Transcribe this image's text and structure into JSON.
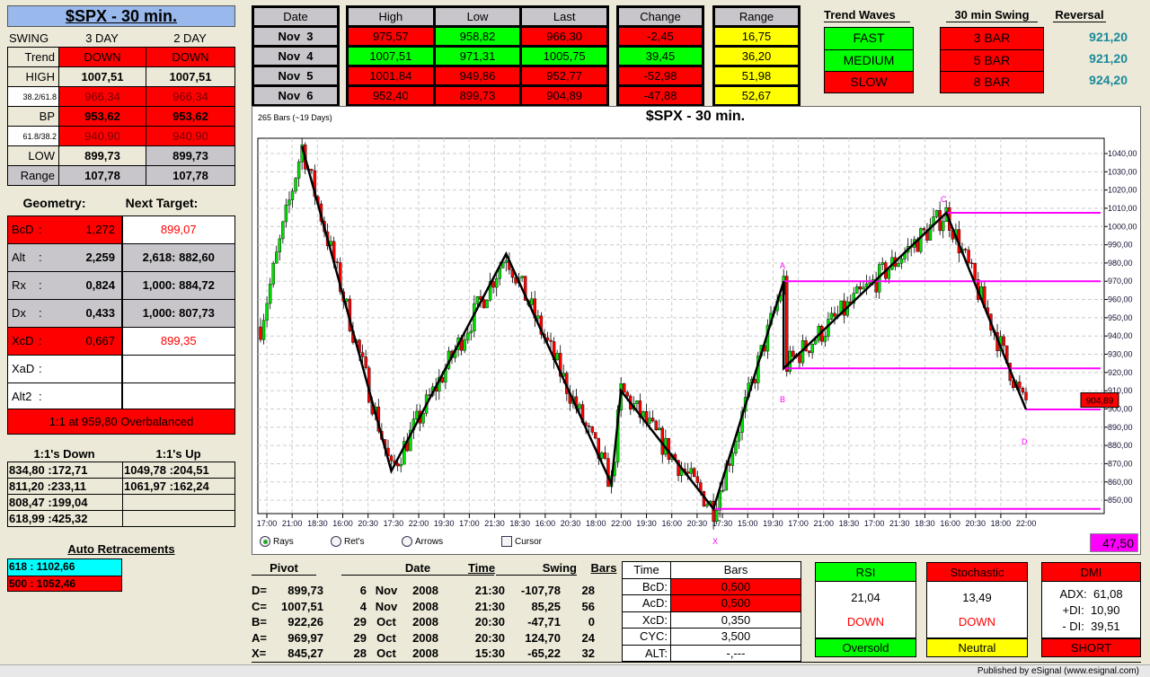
{
  "header": {
    "title": "$SPX - 30 min."
  },
  "swing": {
    "label": "SWING",
    "cols": [
      "3 DAY",
      "2 DAY"
    ],
    "rows": [
      {
        "label": "Trend",
        "values": [
          "DOWN",
          "DOWN"
        ],
        "lc": "beige",
        "vc": [
          "red",
          "red"
        ],
        "tc": ""
      },
      {
        "label": "HIGH",
        "values": [
          "1007,51",
          "1007,51"
        ],
        "lc": "beige",
        "vc": [
          "beige",
          "beige"
        ],
        "tc": "bold"
      },
      {
        "label": "38.2/61.8",
        "values": [
          "966,34",
          "966,34"
        ],
        "lc": "white small",
        "vc": [
          "red",
          "red"
        ],
        "tc": "maroon"
      },
      {
        "label": "BP",
        "values": [
          "953,62",
          "953,62"
        ],
        "lc": "beige",
        "vc": [
          "red",
          "red"
        ],
        "tc": "bold"
      },
      {
        "label": "61.8/38.2",
        "values": [
          "940,90",
          "940,90"
        ],
        "lc": "white small",
        "vc": [
          "red",
          "red"
        ],
        "tc": "maroon"
      },
      {
        "label": "LOW",
        "values": [
          "899,73",
          "899,73"
        ],
        "lc": "beige",
        "vc": [
          "beige",
          "gray"
        ],
        "tc": "bold"
      },
      {
        "label": "Range",
        "values": [
          "107,78",
          "107,78"
        ],
        "lc": "gray",
        "vc": [
          "gray",
          "gray"
        ],
        "tc": "bold"
      }
    ]
  },
  "geometry": {
    "label": "Geometry:",
    "target_label": "Next Target:",
    "rows": [
      {
        "name": "BcD",
        "sep": ":",
        "ratio": "1,272",
        "target": "899,07",
        "lc": "red",
        "tc": "white rtext"
      },
      {
        "name": "Alt",
        "sep": ":",
        "ratio": "2,259",
        "target": "2,618: 882,60",
        "lc": "gray",
        "tc": "gray bold"
      },
      {
        "name": "Rx",
        "sep": ":",
        "ratio": "0,824",
        "target": "1,000: 884,72",
        "lc": "gray",
        "tc": "gray bold"
      },
      {
        "name": "Dx",
        "sep": ":",
        "ratio": "0,433",
        "target": "1,000: 807,73",
        "lc": "gray",
        "tc": "gray bold"
      },
      {
        "name": "XcD",
        "sep": ":",
        "ratio": "0,667",
        "target": "899,35",
        "lc": "red",
        "tc": "white rtext"
      },
      {
        "name": "XaD",
        "sep": ":",
        "ratio": "",
        "target": "",
        "lc": "white",
        "tc": "white"
      },
      {
        "name": "Alt2",
        "sep": ":",
        "ratio": "",
        "target": "",
        "lc": "white",
        "tc": "white"
      }
    ],
    "overbalanced": "1:1 at 959,80 Overbalanced"
  },
  "ones": {
    "down_label": "1:1's Down",
    "up_label": "1:1's Up",
    "down": [
      "834,80 :172,71",
      "811,20 :233,11",
      "808,47 :199,04",
      "618,99 :425,32"
    ],
    "up": [
      "1049,78 :204,51",
      "1061,97 :162,24",
      "",
      ""
    ]
  },
  "auto_retracements": {
    "label": "Auto Retracements",
    "items": [
      {
        "text": "618 : 1102,66",
        "c": "cyan"
      },
      {
        "text": "500 : 1052,46",
        "c": "red"
      }
    ]
  },
  "daily": {
    "headers": {
      "date": "Date",
      "high": "High",
      "low": "Low",
      "last": "Last",
      "change": "Change",
      "range": "Range"
    },
    "rows": [
      {
        "date": "Nov  3",
        "high": "975,57",
        "low": "958,82",
        "last": "966,30",
        "change": "-2,45",
        "range": "16,75",
        "c": [
          "red",
          "green",
          "red",
          "red"
        ]
      },
      {
        "date": "Nov  4",
        "high": "1007,51",
        "low": "971,31",
        "last": "1005,75",
        "change": "39,45",
        "range": "36,20",
        "c": [
          "green",
          "green",
          "green",
          "green"
        ]
      },
      {
        "date": "Nov  5",
        "high": "1001,84",
        "low": "949,86",
        "last": "952,77",
        "change": "-52,98",
        "range": "51,98",
        "c": [
          "red",
          "red",
          "red",
          "red"
        ]
      },
      {
        "date": "Nov  6",
        "high": "952,40",
        "low": "899,73",
        "last": "904,89",
        "change": "-47,88",
        "range": "52,67",
        "c": [
          "red",
          "red",
          "red",
          "red"
        ]
      }
    ]
  },
  "trend": {
    "waves_label": "Trend Waves",
    "swing_label": "30 min Swing",
    "reversal_label": "Reversal",
    "waves": [
      {
        "t": "FAST",
        "c": "green"
      },
      {
        "t": "MEDIUM",
        "c": "green"
      },
      {
        "t": "SLOW",
        "c": "red"
      }
    ],
    "swings": [
      {
        "t": "3 BAR",
        "c": "red"
      },
      {
        "t": "5 BAR",
        "c": "red"
      },
      {
        "t": "8 BAR",
        "c": "red"
      }
    ],
    "reversals": [
      "921,20",
      "921,20",
      "924,20"
    ]
  },
  "chart": {
    "bars_label": "265 Bars (~19 Days)",
    "title": "$SPX - 30 min.",
    "last_price": "904,89",
    "corner_value": "47,50",
    "y_ticks": [
      "1040,00",
      "1030,00",
      "1020,00",
      "1010,00",
      "1000,00",
      "990,00",
      "980,00",
      "970,00",
      "960,00",
      "950,00",
      "940,00",
      "930,00",
      "920,00",
      "910,00",
      "900,00",
      "890,00",
      "880,00",
      "870,00",
      "860,00",
      "850,00"
    ],
    "x_ticks": [
      "17:00",
      "21:00",
      "18:30",
      "16:00",
      "20:30",
      "17:30",
      "22:00",
      "19:30",
      "17:00",
      "21:30",
      "18:30",
      "16:00",
      "20:30",
      "18:00",
      "22:00",
      "19:30",
      "16:00",
      "20:30",
      "17:30",
      "15:00",
      "19:30",
      "17:00",
      "21:00",
      "18:30",
      "17:00",
      "21:30",
      "18:30",
      "16:00",
      "20:30",
      "18:00",
      "22:00"
    ],
    "pivot_labels": {
      "A": "A",
      "B": "B",
      "C": "C",
      "D": "D",
      "X": "X"
    },
    "pivots": [
      {
        "bar": 13,
        "price": 1044
      },
      {
        "bar": 41,
        "price": 866
      },
      {
        "bar": 77,
        "price": 985
      },
      {
        "bar": 110,
        "price": 859
      },
      {
        "bar": 113,
        "price": 910
      },
      {
        "bar": 142,
        "price": 845.27
      },
      {
        "bar": 164,
        "price": 969.97
      },
      {
        "bar": 164,
        "price": 922.26
      },
      {
        "bar": 215,
        "price": 1007.51
      },
      {
        "bar": 240,
        "price": 899.73
      }
    ],
    "levels": [
      {
        "price": 1007.51,
        "from_bar": 215
      },
      {
        "price": 969.97,
        "from_bar": 164
      },
      {
        "price": 922.26,
        "from_bar": 164
      },
      {
        "price": 899.73,
        "from_bar": 240
      },
      {
        "price": 845.27,
        "from_bar": 142
      }
    ],
    "options": {
      "rays": "Rays",
      "rets": "Ret's",
      "arrows": "Arrows",
      "cursor": "Cursor"
    }
  },
  "pivots_table": {
    "headers": [
      "Pivot",
      "Date",
      "Time",
      "Swing",
      "Bars"
    ],
    "rows": [
      {
        "p": "D=",
        "v": "899,73",
        "d": "6",
        "m": "Nov",
        "y": "2008",
        "t": "21:30",
        "s": "-107,78",
        "b": "28"
      },
      {
        "p": "C=",
        "v": "1007,51",
        "d": "4",
        "m": "Nov",
        "y": "2008",
        "t": "21:30",
        "s": "85,25",
        "b": "56"
      },
      {
        "p": "B=",
        "v": "922,26",
        "d": "29",
        "m": "Oct",
        "y": "2008",
        "t": "20:30",
        "s": "-47,71",
        "b": "0"
      },
      {
        "p": "A=",
        "v": "969,97",
        "d": "29",
        "m": "Oct",
        "y": "2008",
        "t": "20:30",
        "s": "124,70",
        "b": "24"
      },
      {
        "p": "X=",
        "v": "845,27",
        "d": "28",
        "m": "Oct",
        "y": "2008",
        "t": "15:30",
        "s": "-65,22",
        "b": "32"
      }
    ]
  },
  "time_bars": {
    "headers": [
      "Time",
      "Bars"
    ],
    "rows": [
      {
        "k": "BcD:",
        "v": "0,500",
        "c": "red"
      },
      {
        "k": "AcD:",
        "v": "0,500",
        "c": "red"
      },
      {
        "k": "XcD:",
        "v": "0,350",
        "c": "white"
      },
      {
        "k": "CYC:",
        "v": "3,500",
        "c": "white"
      },
      {
        "k": "ALT:",
        "v": "-,---",
        "c": "white"
      }
    ]
  },
  "indicators": {
    "rsi": {
      "title": "RSI",
      "value": "21,04",
      "dir": "DOWN",
      "status": "Oversold"
    },
    "stoch": {
      "title": "Stochastic",
      "value": "13,49",
      "dir": "DOWN",
      "status": "Neutral"
    },
    "dmi": {
      "title": "DMI",
      "adx_label": "ADX:",
      "adx": "61,08",
      "pdi_label": "+DI:",
      "pdi": "10,90",
      "mdi_label": "- DI:",
      "mdi": "39,51",
      "status": "SHORT"
    }
  },
  "footer": {
    "text": "Published by eSignal (www.esignal.com)"
  }
}
